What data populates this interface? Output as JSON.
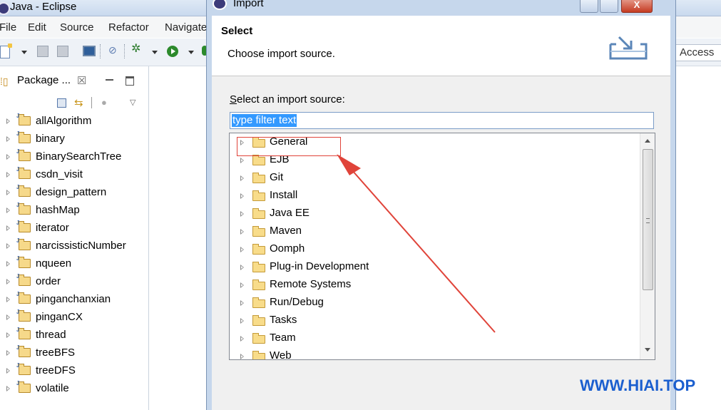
{
  "eclipse": {
    "title": "Java - Eclipse",
    "menu": [
      "File",
      "Edit",
      "Source",
      "Refactor",
      "Navigate"
    ],
    "quick_access": "Access"
  },
  "package_explorer": {
    "tab_label": "Package ...",
    "close_glyph": "☒",
    "projects": [
      "allAlgorithm",
      "binary",
      "BinarySearchTree",
      "csdn_visit",
      "design_pattern",
      "hashMap",
      "iterator",
      "narcissisticNumber",
      "nqueen",
      "order",
      "pinganchanxian",
      "pinganCX",
      "thread",
      "treeBFS",
      "treeDFS",
      "volatile"
    ]
  },
  "dialog": {
    "title": "Import",
    "close_glyph": "X",
    "header_title": "Select",
    "header_desc": "Choose import source.",
    "source_label_first": "S",
    "source_label_rest": "elect an import source:",
    "filter_value": "type filter text",
    "tree_items": [
      "General",
      "EJB",
      "Git",
      "Install",
      "Java EE",
      "Maven",
      "Oomph",
      "Plug-in Development",
      "Remote Systems",
      "Run/Debug",
      "Tasks",
      "Team",
      "Web"
    ]
  },
  "watermark": "WWW.HIAI.TOP",
  "colors": {
    "highlight": "#e0443a",
    "watermark": "#1b5fcf",
    "selection": "#3399ff"
  }
}
